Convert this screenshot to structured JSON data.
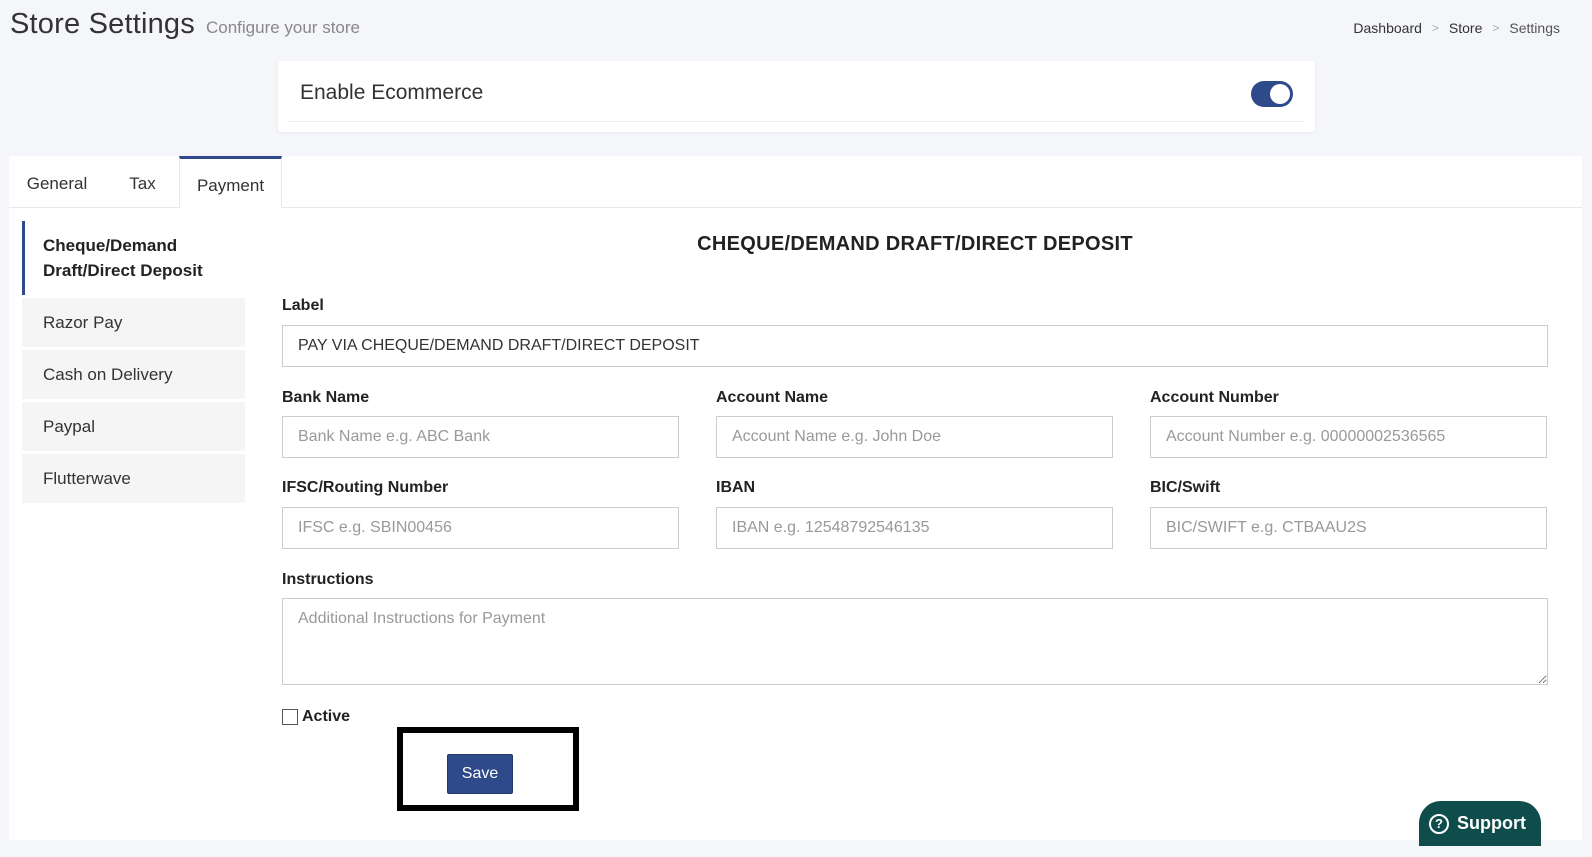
{
  "header": {
    "title": "Store Settings",
    "subtitle": "Configure your store"
  },
  "breadcrumb": {
    "items": [
      "Dashboard",
      "Store",
      "Settings"
    ],
    "separator": ">"
  },
  "ecommerce": {
    "label": "Enable Ecommerce",
    "enabled": true
  },
  "tabs": [
    {
      "label": "General",
      "active": false
    },
    {
      "label": "Tax",
      "active": false
    },
    {
      "label": "Payment",
      "active": true
    }
  ],
  "side_nav": [
    {
      "label": "Cheque/Demand Draft/Direct Deposit",
      "active": true
    },
    {
      "label": "Razor Pay",
      "active": false
    },
    {
      "label": "Cash on Delivery",
      "active": false
    },
    {
      "label": "Paypal",
      "active": false
    },
    {
      "label": "Flutterwave",
      "active": false
    }
  ],
  "form": {
    "heading": "CHEQUE/DEMAND DRAFT/DIRECT DEPOSIT",
    "label_field": {
      "label": "Label",
      "value": "PAY VIA CHEQUE/DEMAND DRAFT/DIRECT DEPOSIT"
    },
    "bank_name": {
      "label": "Bank Name",
      "placeholder": "Bank Name e.g. ABC Bank"
    },
    "account_name": {
      "label": "Account Name",
      "placeholder": "Account Name e.g. John Doe"
    },
    "account_number": {
      "label": "Account Number",
      "placeholder": "Account Number e.g. 00000002536565"
    },
    "ifsc": {
      "label": "IFSC/Routing Number",
      "placeholder": "IFSC e.g. SBIN00456"
    },
    "iban": {
      "label": "IBAN",
      "placeholder": "IBAN e.g. 12548792546135"
    },
    "bic": {
      "label": "BIC/Swift",
      "placeholder": "BIC/SWIFT e.g. CTBAAU2S"
    },
    "instructions": {
      "label": "Instructions",
      "placeholder": "Additional Instructions for Payment"
    },
    "active": {
      "label": "Active",
      "checked": false
    },
    "save_label": "Save"
  },
  "support": {
    "label": "Support",
    "icon": "help-circle-icon"
  },
  "colors": {
    "accent": "#2e4a8a",
    "support": "#0f4c4c"
  }
}
